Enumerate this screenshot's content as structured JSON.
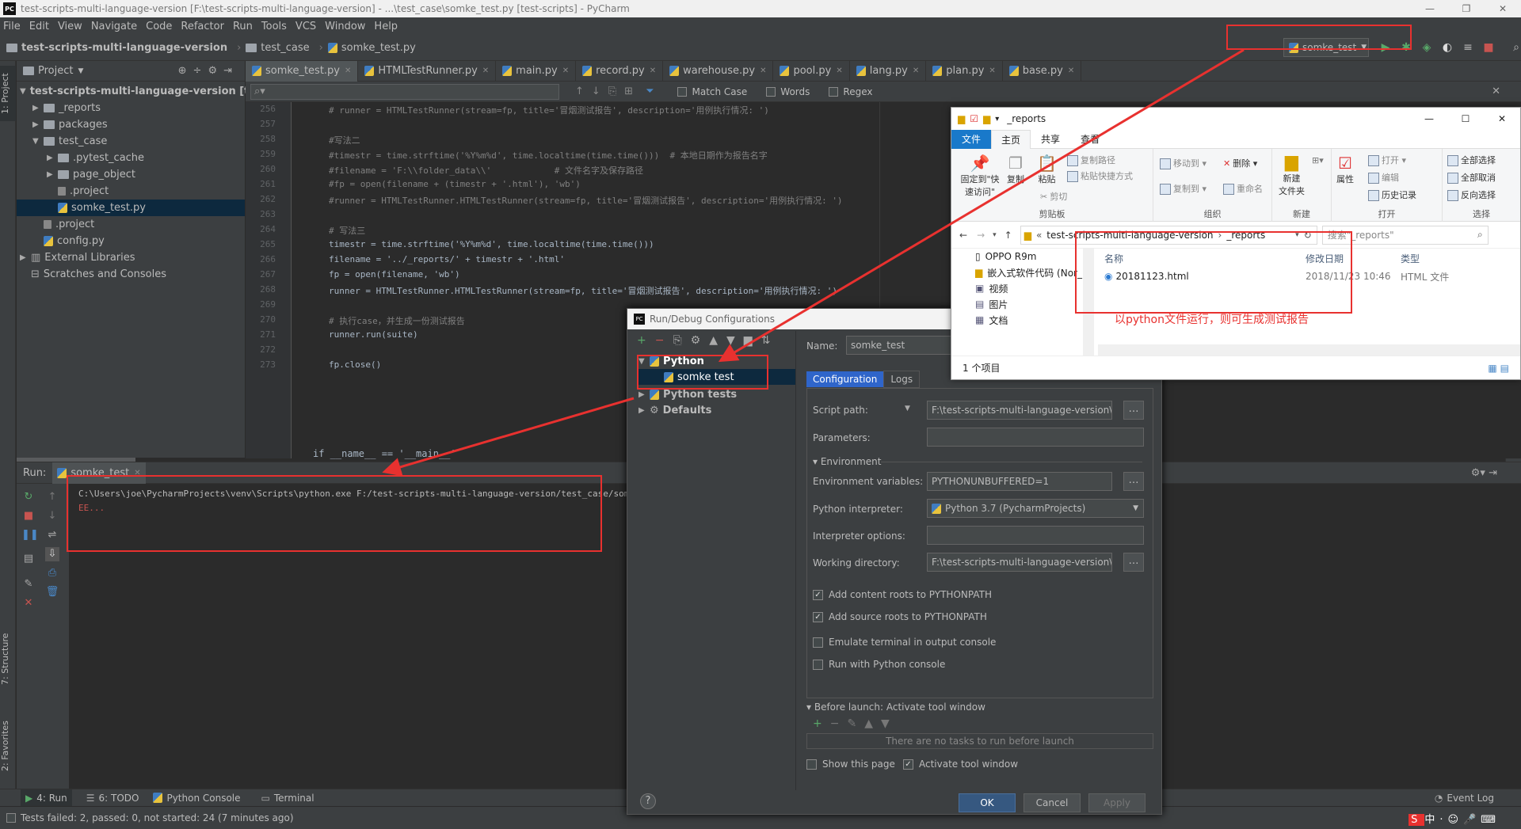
{
  "window": {
    "title": "test-scripts-multi-language-version [F:\\test-scripts-multi-language-version] - ...\\test_case\\somke_test.py [test-scripts] - PyCharm",
    "app_icon": "PC"
  },
  "menu": [
    "File",
    "Edit",
    "View",
    "Navigate",
    "Code",
    "Refactor",
    "Run",
    "Tools",
    "VCS",
    "Window",
    "Help"
  ],
  "breadcrumb": [
    "test-scripts-multi-language-version",
    "test_case",
    "somke_test.py"
  ],
  "run_config": "somke_test",
  "sidebar_tabs": {
    "project": "1: Project",
    "structure": "7: Structure",
    "favorites": "2: Favorites"
  },
  "project_panel": {
    "title": "Project",
    "tree": [
      {
        "label": "test-scripts-multi-language-version [test-s",
        "type": "folder",
        "open": true
      },
      {
        "label": "_reports",
        "type": "folder"
      },
      {
        "label": "packages",
        "type": "folder"
      },
      {
        "label": "test_case",
        "type": "folder",
        "open": true
      },
      {
        "label": ".pytest_cache",
        "type": "folder"
      },
      {
        "label": "page_object",
        "type": "folder"
      },
      {
        "label": ".project",
        "type": "file"
      },
      {
        "label": "somke_test.py",
        "type": "py"
      },
      {
        "label": ".project",
        "type": "file"
      },
      {
        "label": "config.py",
        "type": "py"
      },
      {
        "label": "External Libraries",
        "type": "lib"
      },
      {
        "label": "Scratches and Consoles",
        "type": "scratch"
      }
    ]
  },
  "editor_tabs": [
    "somke_test.py",
    "HTMLTestRunner.py",
    "main.py",
    "record.py",
    "warehouse.py",
    "pool.py",
    "lang.py",
    "plan.py",
    "base.py"
  ],
  "search": {
    "match_case": "Match Case",
    "words": "Words",
    "regex": "Regex"
  },
  "code": [
    {
      "n": "256",
      "t": "# runner = HTMLTestRunner(stream=fp, title='冒烟测试报告', description='用例执行情况: ')",
      "c": "cmt"
    },
    {
      "n": "257",
      "t": "",
      "c": ""
    },
    {
      "n": "258",
      "t": "#写法二",
      "c": "cmt"
    },
    {
      "n": "259",
      "t": "#timestr = time.strftime('%Y%m%d', time.localtime(time.time()))  # 本地日期作为报告名字",
      "c": "cmt"
    },
    {
      "n": "260",
      "t": "#filename = 'F:\\\\folder_data\\\\'            # 文件名字及保存路径",
      "c": "cmt"
    },
    {
      "n": "261",
      "t": "#fp = open(filename + (timestr + '.html'), 'wb')",
      "c": "cmt"
    },
    {
      "n": "262",
      "t": "#runner = HTMLTestRunner.HTMLTestRunner(stream=fp, title='冒烟测试报告', description='用例执行情况: ')",
      "c": "cmt"
    },
    {
      "n": "263",
      "t": "",
      "c": ""
    },
    {
      "n": "264",
      "t": "# 写法三",
      "c": "cmt"
    },
    {
      "n": "265",
      "t": "timestr = time.strftime('%Y%m%d', time.localtime(time.time()))",
      "c": ""
    },
    {
      "n": "266",
      "t": "filename = '../_reports/' + timestr + '.html'",
      "c": ""
    },
    {
      "n": "267",
      "t": "fp = open(filename, 'wb')",
      "c": ""
    },
    {
      "n": "268",
      "t": "runner = HTMLTestRunner.HTMLTestRunner(stream=fp, title='冒烟测试报告', description='用例执行情况: ')",
      "c": ""
    },
    {
      "n": "269",
      "t": "",
      "c": ""
    },
    {
      "n": "270",
      "t": "# 执行case，并生成一份测试报告",
      "c": "cmt"
    },
    {
      "n": "271",
      "t": "runner.run(suite)",
      "c": ""
    },
    {
      "n": "272",
      "t": "",
      "c": ""
    },
    {
      "n": "273",
      "t": "fp.close()",
      "c": ""
    }
  ],
  "code_footer": "if __name__ == '__main__'",
  "run_panel": {
    "label": "Run:",
    "tab": "somke_test",
    "output": [
      "C:\\Users\\joe\\PycharmProjects\\venv\\Scripts\\python.exe F:/test-scripts-multi-language-version/test_case/somke_test.py",
      "EE..."
    ]
  },
  "bottom_tabs": [
    "4: Run",
    "6: TODO",
    "Python Console",
    "Terminal"
  ],
  "event_log": "Event Log",
  "status": "Tests failed: 2, passed: 0, not started: 24 (7 minutes ago)",
  "dialog": {
    "title": "Run/Debug Configurations",
    "tree": [
      {
        "label": "Python",
        "bold": true,
        "open": true
      },
      {
        "label": "somke test",
        "bold": false,
        "child": true
      },
      {
        "label": "Python tests",
        "bold": true
      },
      {
        "label": "Defaults",
        "bold": true
      }
    ],
    "name_label": "Name:",
    "name_value": "somke_test",
    "tabs": [
      "Configuration",
      "Logs"
    ],
    "script_path_label": "Script path:",
    "script_path": "F:\\test-scripts-multi-language-version\\te",
    "parameters_label": "Parameters:",
    "environment_section": "Environment",
    "env_vars_label": "Environment variables:",
    "env_vars": "PYTHONUNBUFFERED=1",
    "interpreter_label": "Python interpreter:",
    "interpreter": "Python 3.7 (PycharmProjects)",
    "interp_options_label": "Interpreter options:",
    "workdir_label": "Working directory:",
    "workdir": "F:\\test-scripts-multi-language-version\\te",
    "checks": [
      {
        "label": "Add content roots to PYTHONPATH",
        "checked": true
      },
      {
        "label": "Add source roots to PYTHONPATH",
        "checked": true
      },
      {
        "label": "Emulate terminal in output console",
        "checked": false
      },
      {
        "label": "Run with Python console",
        "checked": false
      }
    ],
    "before_launch": "Before launch: Activate tool window",
    "no_tasks": "There are no tasks to run before launch",
    "show_page": "Show this page",
    "activate_tool": "Activate tool window",
    "ok": "OK",
    "cancel": "Cancel",
    "apply": "Apply"
  },
  "explorer": {
    "title": "_reports",
    "tabs": [
      "文件",
      "主页",
      "共享",
      "查看"
    ],
    "ribbon": {
      "pin": "固定到\"快速访问\"",
      "copy": "复制",
      "paste": "粘贴",
      "copy_path": "复制路径",
      "paste_shortcut": "粘贴快捷方式",
      "cut": "剪切",
      "clipboard": "剪贴板",
      "move_to": "移动到",
      "copy_to": "复制到",
      "delete": "删除",
      "rename": "重命名",
      "organize": "组织",
      "new_folder": "新建\n文件夹",
      "new": "新建",
      "properties": "属性",
      "open": "打开",
      "edit": "编辑",
      "history": "历史记录",
      "open_group": "打开",
      "select_all": "全部选择",
      "select_none": "全部取消",
      "invert": "反向选择",
      "select": "选择"
    },
    "path": [
      "test-scripts-multi-language-version",
      "_reports"
    ],
    "search_placeholder": "搜索\"_reports\"",
    "nav": [
      "OPPO R9m",
      "嵌入式软件代码 (Nor_n",
      "视频",
      "图片",
      "文档"
    ],
    "columns": [
      "名称",
      "修改日期",
      "类型"
    ],
    "files": [
      {
        "name": "20181123.html",
        "date": "2018/11/23 10:46",
        "type": "HTML 文件"
      }
    ],
    "count": "1 个项目"
  },
  "annotation": "以python文件运行，则可生成测试报告",
  "colors": {
    "annotation": "#e8312f",
    "selection": "#0d293e",
    "accent": "#4a88c7"
  }
}
